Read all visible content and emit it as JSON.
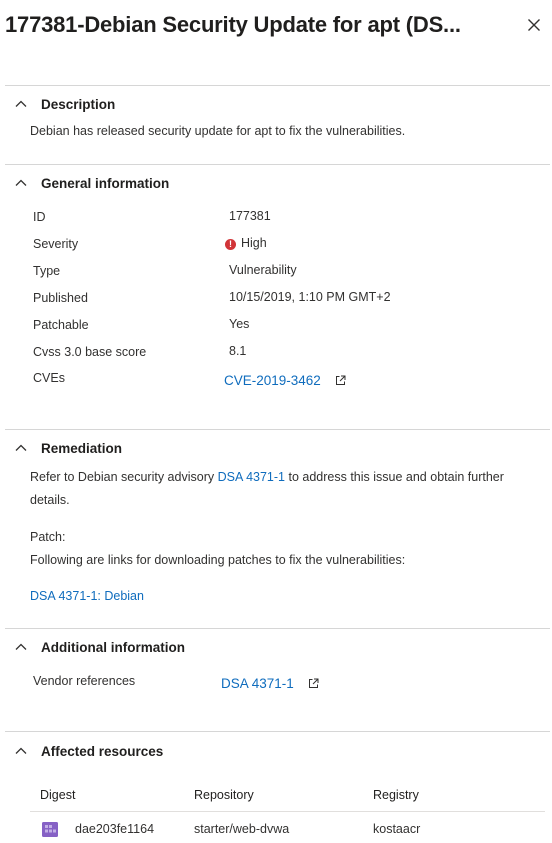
{
  "panel": {
    "title": "177381-Debian Security Update for apt (DS..."
  },
  "icons": {
    "close": "close-icon",
    "chevron": "chevron-up-icon",
    "external": "external-link-icon",
    "severity": "error-circle-icon",
    "container_image": "container-image-icon"
  },
  "colors": {
    "link": "#0f6cbd",
    "severity_high": "#d13438",
    "image_icon": "#8661c5"
  },
  "description": {
    "heading": "Description",
    "text": "Debian has released security update for apt to fix the vulnerabilities."
  },
  "general": {
    "heading": "General information",
    "rows": [
      {
        "key": "ID",
        "value": "177381"
      },
      {
        "key": "Severity",
        "value": "High"
      },
      {
        "key": "Type",
        "value": "Vulnerability"
      },
      {
        "key": "Published",
        "value": "10/15/2019, 1:10 PM GMT+2"
      },
      {
        "key": "Patchable",
        "value": "Yes"
      },
      {
        "key": "Cvss 3.0 base score",
        "value": "8.1"
      },
      {
        "key": "CVEs",
        "value": "CVE-2019-3462"
      }
    ]
  },
  "remediation": {
    "heading": "Remediation",
    "line1_prefix": "Refer to Debian security advisory ",
    "line1_link": "DSA 4371-1",
    "line1_suffix": " to address this issue and obtain further",
    "line2": "details.",
    "patch_label": "Patch:",
    "patch_text": "Following are links for downloading patches to fix the vulnerabilities:",
    "patch_link": "DSA 4371-1: Debian"
  },
  "additional": {
    "heading": "Additional information",
    "vendor_key": "Vendor references",
    "vendor_link": "DSA 4371-1"
  },
  "affected": {
    "heading": "Affected resources",
    "columns": [
      "Digest",
      "Repository",
      "Registry"
    ],
    "rows": [
      {
        "digest": "dae203fe1164",
        "repository": "starter/web-dvwa",
        "registry": "kostaacr"
      }
    ]
  }
}
